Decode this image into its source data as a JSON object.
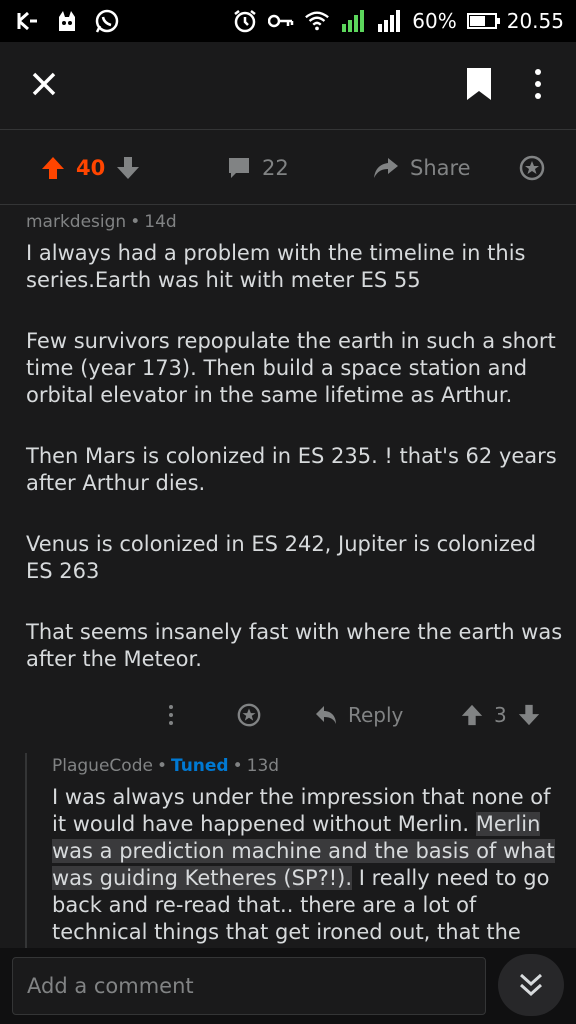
{
  "status_bar": {
    "battery_percent": "60%",
    "battery_level": 0.6,
    "time": "20.55",
    "icons": [
      "k-icon",
      "cat-icon",
      "whatsapp-icon",
      "alarm-icon",
      "key-icon",
      "wifi-icon",
      "signal-1-icon",
      "signal-2-icon",
      "battery-icon"
    ]
  },
  "app_bar": {
    "icons": [
      "close-icon",
      "bookmark-icon",
      "more-vertical-icon"
    ]
  },
  "post_actions": {
    "votes": "40",
    "comments": "22",
    "share_label": "Share"
  },
  "comment1": {
    "author": "markdesign",
    "age": "14d",
    "paragraphs": [
      "I always had a problem with the timeline in this series.Earth was hit with meter ES 55",
      "Few survivors repopulate the earth in such a short time (year 173). Then build a space station and orbital elevator in the same lifetime as Arthur.",
      "Then Mars is colonized in ES 235. ! that's 62 years after Arthur dies.",
      "Venus is colonized in ES 242, Jupiter is colonized ES 263",
      "That seems insanely fast with where the earth was after the Meteor."
    ],
    "reply_label": "Reply",
    "votes": "3"
  },
  "comment2": {
    "author": "PlagueCode",
    "flair": "Tuned",
    "age": "13d",
    "text_plain_1": "I was always under the impression that none of it would have happened without Merlin. ",
    "text_highlight": "Merlin was a prediction machine and the basis of what was guiding Ketheres (SP?!).",
    "text_plain_2": " I really need to go back and re-read that.. there are a lot of technical things that get ironed out, that the"
  },
  "bottom_bar": {
    "placeholder": "Add a comment"
  },
  "colors": {
    "upvote": "#ff4500",
    "tuned": "#0079d3",
    "background": "#1a1a1b",
    "muted": "#818384"
  }
}
